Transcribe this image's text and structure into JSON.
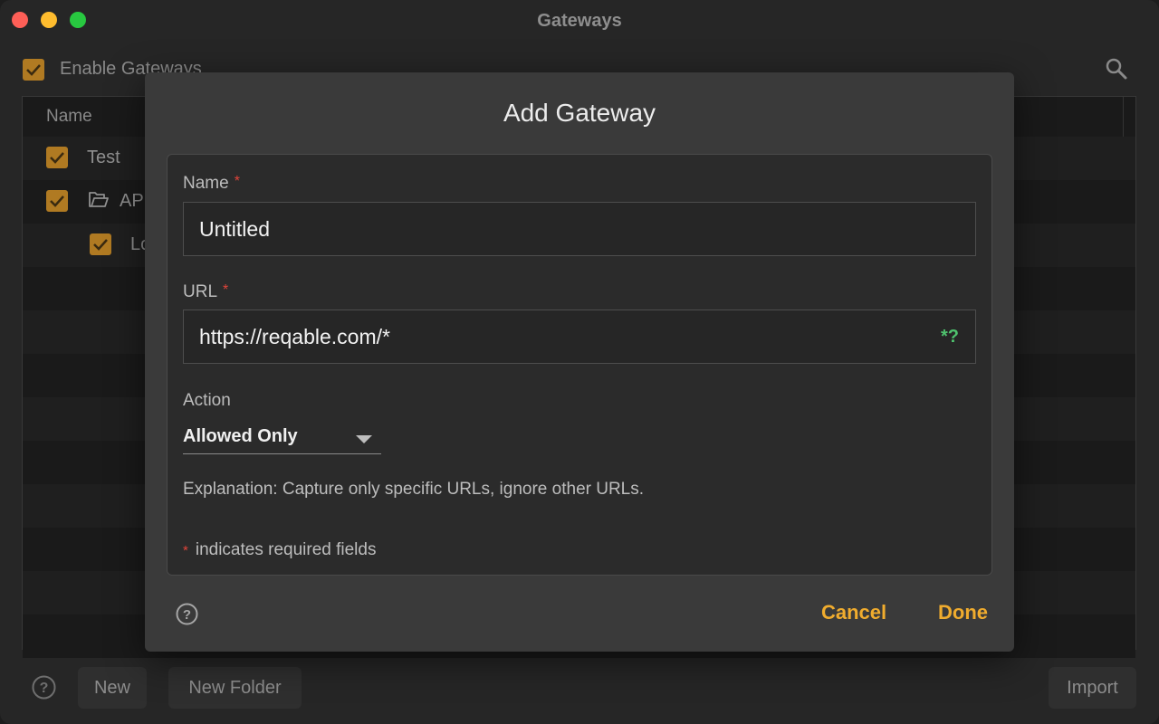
{
  "window": {
    "title": "Gateways"
  },
  "toolbar": {
    "enable_label": "Enable Gateways",
    "enable_checked": true
  },
  "list": {
    "header_name": "Name",
    "rows": [
      {
        "label": "Test",
        "type": "item",
        "checked": true
      },
      {
        "label": "AP",
        "type": "folder",
        "checked": true
      },
      {
        "label": "Lo",
        "type": "item",
        "checked": true
      }
    ]
  },
  "bottom_bar": {
    "new_label": "New",
    "new_folder_label": "New Folder",
    "import_label": "Import"
  },
  "dialog": {
    "title": "Add Gateway",
    "name_label": "Name",
    "name_value": "Untitled",
    "url_label": "URL",
    "url_value": "https://reqable.com/*",
    "regex_toggle": "*?",
    "action_label": "Action",
    "action_value": "Allowed Only",
    "explanation": "Explanation: Capture only specific URLs, ignore other URLs.",
    "required_marker": "*",
    "required_note": "indicates required fields",
    "cancel_label": "Cancel",
    "done_label": "Done"
  },
  "colors": {
    "accent": "#f0ac2e",
    "checkbox": "#b07a22",
    "required": "#e0443a",
    "regex": "#4fc26e"
  }
}
